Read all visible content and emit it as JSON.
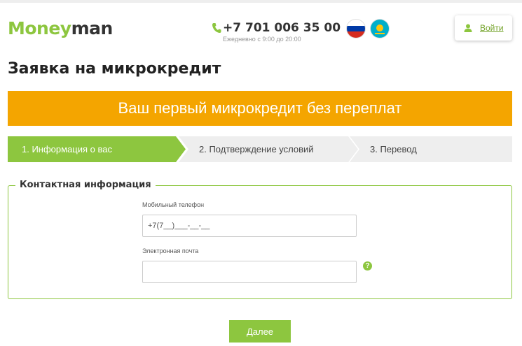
{
  "header": {
    "logo_part1": "Money",
    "logo_part2": "man",
    "phone": "+7 701 006 35 00",
    "hours": "Ежедневно с 9:00 до 20:00",
    "languages": [
      {
        "code": "ru",
        "icon": "russia-flag-icon"
      },
      {
        "code": "kz",
        "icon": "kazakhstan-flag-icon"
      }
    ],
    "login_label": "Войти"
  },
  "page": {
    "title": "Заявка на микрокредит",
    "banner": "Ваш первый микрокредит без переплат"
  },
  "steps": [
    {
      "label": "1. Информация о вас",
      "active": true
    },
    {
      "label": "2. Подтверждение условий",
      "active": false
    },
    {
      "label": "3. Перевод",
      "active": false
    }
  ],
  "form": {
    "legend": "Контактная информация",
    "phone_label": "Мобильный телефон",
    "phone_value": "+7(7__)___-__-__",
    "email_label": "Электронная почта",
    "email_value": "",
    "help_icon": "?",
    "submit_label": "Далее"
  },
  "colors": {
    "brand_green": "#8dc63f",
    "banner_orange": "#f4a500",
    "step_inactive": "#eeeeee"
  }
}
